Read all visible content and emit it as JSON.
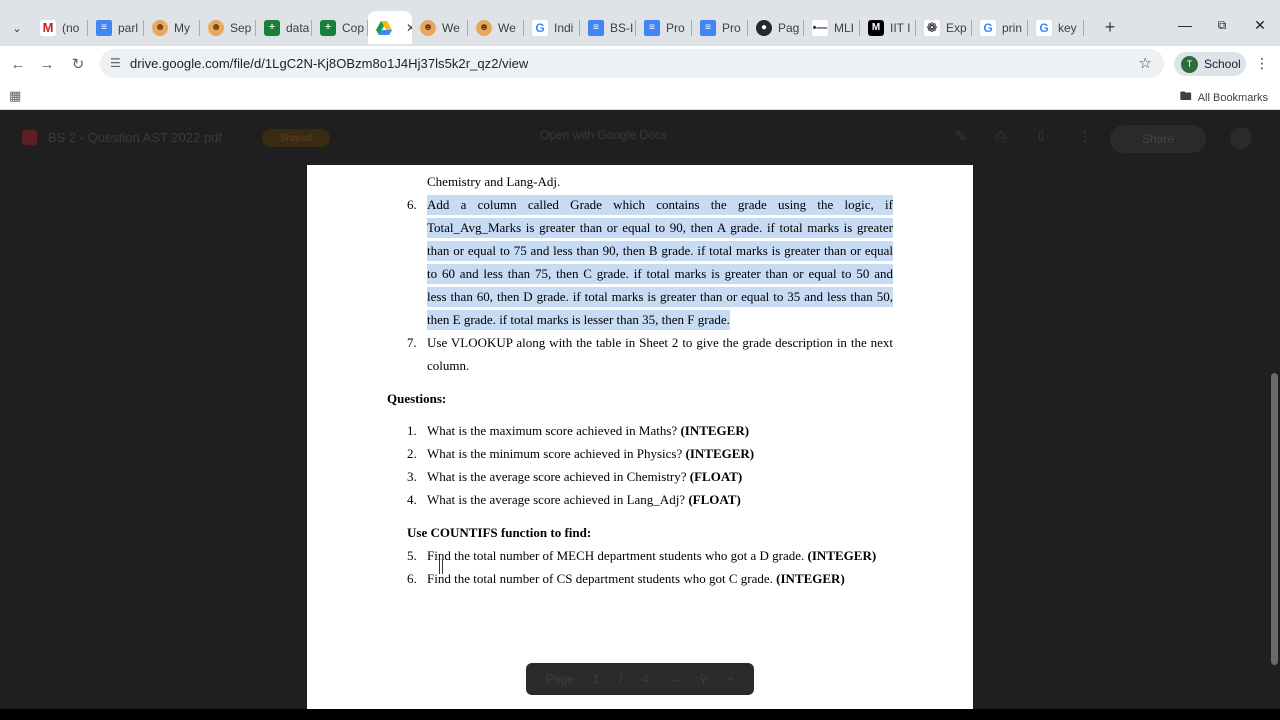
{
  "browser": {
    "tabs": [
      {
        "label": "(no",
        "favicon": "gmail-icon"
      },
      {
        "label": "parl",
        "favicon": "docs-icon"
      },
      {
        "label": "My",
        "favicon": "smile-icon"
      },
      {
        "label": "Sep",
        "favicon": "smile-icon"
      },
      {
        "label": "data",
        "favicon": "sheets-icon"
      },
      {
        "label": "Cop",
        "favicon": "sheets-icon"
      },
      {
        "label": "",
        "favicon": "drive-icon",
        "active": true
      },
      {
        "label": "We",
        "favicon": "smile-icon"
      },
      {
        "label": "We",
        "favicon": "smile-icon"
      },
      {
        "label": "Indi",
        "favicon": "google-icon"
      },
      {
        "label": "BS-I",
        "favicon": "docs-icon"
      },
      {
        "label": "Pro",
        "favicon": "docs-icon"
      },
      {
        "label": "Pro",
        "favicon": "docs-icon"
      },
      {
        "label": "Pag",
        "favicon": "github-icon"
      },
      {
        "label": "MLI",
        "favicon": "mu-icon"
      },
      {
        "label": "IIT I",
        "favicon": "medium-icon"
      },
      {
        "label": "Exp",
        "favicon": "openai-icon"
      },
      {
        "label": "prin",
        "favicon": "google-icon"
      },
      {
        "label": "key",
        "favicon": "google-icon"
      }
    ],
    "url": "drive.google.com/file/d/1LgC2N-Kj8OBzm8o1J4Hj37ls5k2r_qz2/view",
    "profile_label": "School",
    "profile_initial": "T",
    "all_bookmarks_label": "All Bookmarks"
  },
  "viewer": {
    "file_title": "BS 2 - Question AST 2022.pdf",
    "badge": "Shared",
    "open_with": "Open with Google Docs",
    "share_label": "Share",
    "pager": {
      "label": "Page",
      "current": "1",
      "sep": "/",
      "total": "4"
    }
  },
  "document": {
    "line_prev": "Chemistry and Lang-Adj.",
    "item6_num": "6.",
    "item6_lines": [
      "Add a column called Grade which contains the grade using the logic, if",
      "Total_Avg_Marks is greater than or equal to 90, then A grade. if total marks is greater",
      "than or equal to 75 and less than 90, then B grade. if total marks is greater than or equal",
      "to 60 and less than 75, then C grade. if total marks is greater than or equal to 50 and",
      "less than 60, then D grade. if total marks is greater than or equal to 35 and less than 50,",
      "then E grade. if total marks is lesser than 35, then F grade."
    ],
    "item7_num": "7.",
    "item7_lines": [
      "Use VLOOKUP along with the table in Sheet 2 to give the grade description in the next",
      "column."
    ],
    "questions_heading": "Questions:",
    "questions": [
      {
        "num": "1.",
        "text": "What is the maximum score achieved in Maths?",
        "type": "(INTEGER)"
      },
      {
        "num": "2.",
        "text": "What is the minimum score achieved in Physics?",
        "type": "(INTEGER)"
      },
      {
        "num": "3.",
        "text": "What is the average score achieved in Chemistry?",
        "type": "(FLOAT)"
      },
      {
        "num": "4.",
        "text": "What is the average score achieved in Lang_Adj?",
        "type": "(FLOAT)"
      }
    ],
    "countifs_heading": "Use COUNTIFS function to find:",
    "countifs_questions": [
      {
        "num": "5.",
        "text": "Find the total number of MECH department students who got a D grade.",
        "type": "(INTEGER)"
      },
      {
        "num": "6.",
        "text": "Find the total number of CS department students who got C grade.",
        "type": "(INTEGER)"
      }
    ]
  },
  "colors": {
    "highlight": "#c7dbf5",
    "viewer_bg": "#1f1f1f",
    "tabstrip_bg": "#dfe3e8"
  }
}
